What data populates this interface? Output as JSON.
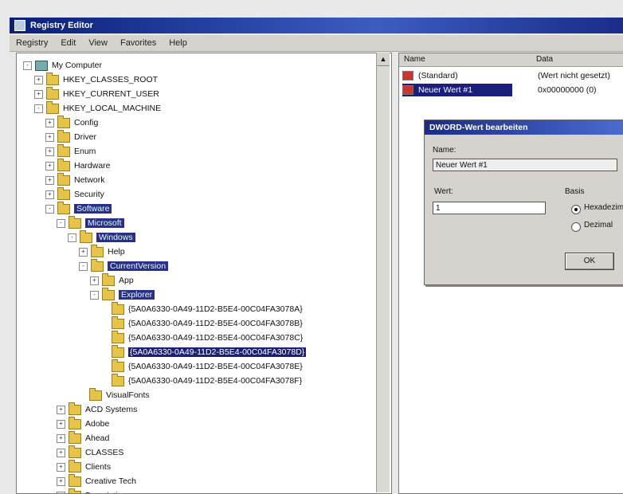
{
  "window": {
    "title": "Registry Editor"
  },
  "menu": [
    "Registry",
    "Edit",
    "View",
    "Favorites",
    "Help"
  ],
  "tree": [
    {
      "label": "My Computer",
      "level": 0,
      "type": "computer",
      "exp": "-"
    },
    {
      "label": "HKEY_CLASSES_ROOT",
      "level": 1,
      "type": "folder",
      "exp": "+"
    },
    {
      "label": "HKEY_CURRENT_USER",
      "level": 1,
      "type": "folder",
      "exp": "+"
    },
    {
      "label": "HKEY_LOCAL_MACHINE",
      "level": 1,
      "type": "folder",
      "exp": "-"
    },
    {
      "label": "Config",
      "level": 2,
      "type": "folder",
      "exp": "+"
    },
    {
      "label": "Driver",
      "level": 2,
      "type": "folder",
      "exp": "+"
    },
    {
      "label": "Enum",
      "level": 2,
      "type": "folder",
      "exp": "+"
    },
    {
      "label": "Hardware",
      "level": 2,
      "type": "folder",
      "exp": "+"
    },
    {
      "label": "Network",
      "level": 2,
      "type": "folder",
      "exp": "+"
    },
    {
      "label": "Security",
      "level": 2,
      "type": "folder",
      "exp": "+"
    },
    {
      "label": "Software",
      "level": 2,
      "type": "folder",
      "exp": "-",
      "hl": true
    },
    {
      "label": "Microsoft",
      "level": 3,
      "type": "folder",
      "exp": "-",
      "hl": true
    },
    {
      "label": "Windows",
      "level": 4,
      "type": "folder",
      "exp": "-",
      "hl": true
    },
    {
      "label": "Help",
      "level": 5,
      "type": "folder",
      "exp": "+"
    },
    {
      "label": "CurrentVersion",
      "level": 5,
      "type": "folder",
      "exp": "-",
      "hl": true
    },
    {
      "label": "App",
      "level": 6,
      "type": "folder",
      "exp": "+"
    },
    {
      "label": "Explorer",
      "level": 6,
      "type": "folder",
      "exp": "-",
      "hl": true
    },
    {
      "label": "{5A0A6330-0A49-11D2-B5E4-00C04FA3078A}",
      "level": 7,
      "type": "folder",
      "exp": ""
    },
    {
      "label": "{5A0A6330-0A49-11D2-B5E4-00C04FA3078B}",
      "level": 7,
      "type": "folder",
      "exp": ""
    },
    {
      "label": "{5A0A6330-0A49-11D2-B5E4-00C04FA3078C}",
      "level": 7,
      "type": "folder",
      "exp": ""
    },
    {
      "label": "{5A0A6330-0A49-11D2-B5E4-00C04FA3078D}",
      "level": 7,
      "type": "folder",
      "exp": "",
      "sel": true
    },
    {
      "label": "{5A0A6330-0A49-11D2-B5E4-00C04FA3078E}",
      "level": 7,
      "type": "folder",
      "exp": ""
    },
    {
      "label": "{5A0A6330-0A49-11D2-B5E4-00C04FA3078F}",
      "level": 7,
      "type": "folder",
      "exp": ""
    },
    {
      "label": "VisualFonts",
      "level": 5,
      "type": "folder",
      "exp": ""
    },
    {
      "label": "ACD Systems",
      "level": 3,
      "type": "folder",
      "exp": "+"
    },
    {
      "label": "Adobe",
      "level": 3,
      "type": "folder",
      "exp": "+"
    },
    {
      "label": "Ahead",
      "level": 3,
      "type": "folder",
      "exp": "+"
    },
    {
      "label": "CLASSES",
      "level": 3,
      "type": "folder",
      "exp": "+"
    },
    {
      "label": "Clients",
      "level": 3,
      "type": "folder",
      "exp": "+"
    },
    {
      "label": "Creative Tech",
      "level": 3,
      "type": "folder",
      "exp": "+"
    },
    {
      "label": "Description",
      "level": 3,
      "type": "folder",
      "exp": "+"
    }
  ],
  "list": {
    "col_name": "Name",
    "col_data": "Data",
    "rows": [
      {
        "name": "(Standard)",
        "data": "(Wert nicht gesetzt)",
        "sel": false
      },
      {
        "name": "Neuer Wert #1",
        "data": "0x00000000 (0)",
        "sel": true
      }
    ]
  },
  "dialog": {
    "title": "DWORD-Wert bearbeiten",
    "name_label": "Name:",
    "name_value": "Neuer Wert #1",
    "value_label": "Wert:",
    "value_value": "1",
    "base_label": "Basis",
    "hex_label": "Hexadezimal",
    "dec_label": "Dezimal",
    "ok_label": "OK"
  }
}
